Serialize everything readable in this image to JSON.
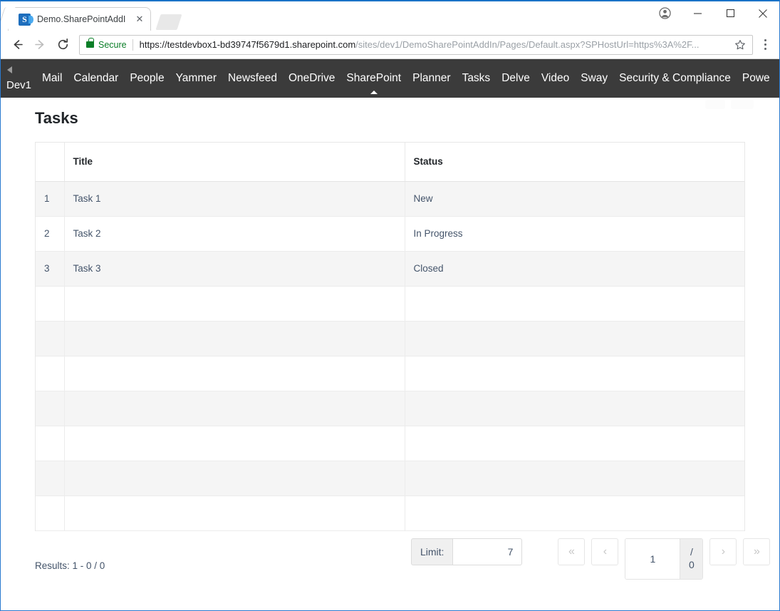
{
  "browser": {
    "tab": {
      "title": "Demo.SharePointAddIn",
      "favicon_letter": "S",
      "close_label": "✕"
    },
    "window_controls": {
      "profile": "profile-icon",
      "minimize": "–",
      "maximize": "□",
      "close": "✕"
    },
    "toolbar": {
      "back": "←",
      "forward": "→",
      "reload": "⟳",
      "security_label": "Secure",
      "url_host": "https://testdevbox1-bd39747f5679d1.sharepoint.com",
      "url_path": "/sites/dev1/DemoSharePointAddIn/Pages/Default.aspx?SPHostUrl=https%3A%2F...",
      "bookmark": "☆"
    }
  },
  "suitebar": {
    "site_name": "Dev1",
    "back_arrow": "back-arrow-icon",
    "links": [
      {
        "label": "Mail",
        "active": false
      },
      {
        "label": "Calendar",
        "active": false
      },
      {
        "label": "People",
        "active": false
      },
      {
        "label": "Yammer",
        "active": false
      },
      {
        "label": "Newsfeed",
        "active": false
      },
      {
        "label": "OneDrive",
        "active": false
      },
      {
        "label": "SharePoint",
        "active": true
      },
      {
        "label": "Planner",
        "active": false
      },
      {
        "label": "Tasks",
        "active": false
      },
      {
        "label": "Delve",
        "active": false
      },
      {
        "label": "Video",
        "active": false
      },
      {
        "label": "Sway",
        "active": false
      },
      {
        "label": "Security & Compliance",
        "active": false
      },
      {
        "label": "Powe",
        "active": false
      }
    ]
  },
  "page": {
    "title": "Tasks"
  },
  "table": {
    "columns": [
      "",
      "Title",
      "Status"
    ],
    "rows": [
      {
        "index": "1",
        "title": "Task 1",
        "status": "New"
      },
      {
        "index": "2",
        "title": "Task 2",
        "status": "In Progress"
      },
      {
        "index": "3",
        "title": "Task 3",
        "status": "Closed"
      },
      {
        "index": "",
        "title": "",
        "status": ""
      },
      {
        "index": "",
        "title": "",
        "status": ""
      },
      {
        "index": "",
        "title": "",
        "status": ""
      },
      {
        "index": "",
        "title": "",
        "status": ""
      },
      {
        "index": "",
        "title": "",
        "status": ""
      },
      {
        "index": "",
        "title": "",
        "status": ""
      },
      {
        "index": "",
        "title": "",
        "status": ""
      }
    ]
  },
  "footer": {
    "results_text": "Results: 1 - 0 / 0",
    "limit_label": "Limit:",
    "limit_value": "7",
    "pager": {
      "first": "«",
      "prev": "‹",
      "next": "›",
      "last": "»",
      "current_page": "1",
      "total_separator": "/",
      "total_pages": "0"
    }
  },
  "colors": {
    "suitebar_bg": "#3b3b3b",
    "window_border": "#2a7ad0",
    "secure_green": "#0a7e27",
    "text_primary": "#212529",
    "text_muted": "#44546a",
    "row_stripe": "#f5f5f5"
  }
}
